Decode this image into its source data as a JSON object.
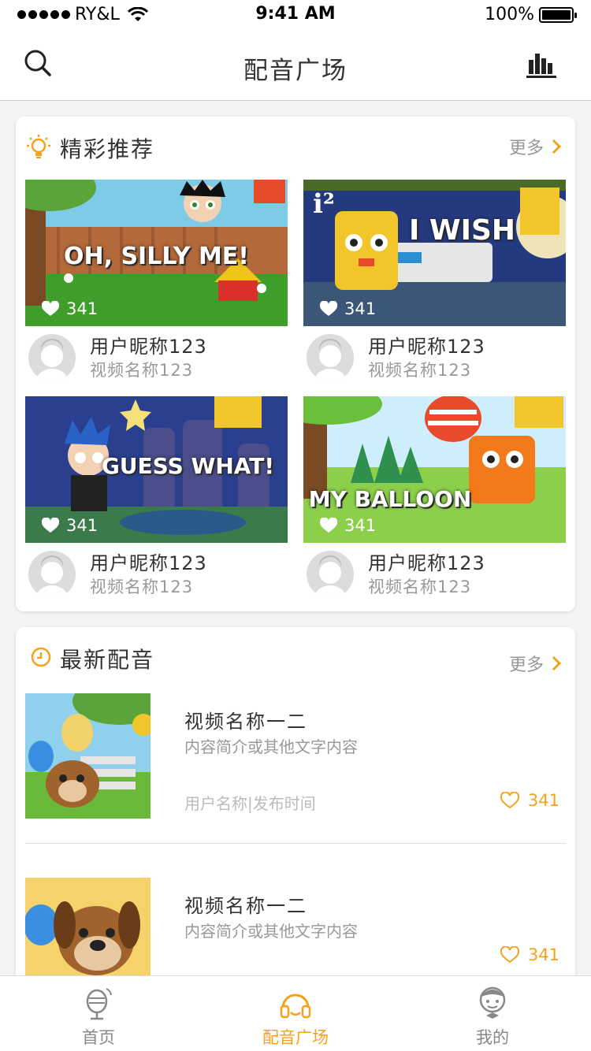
{
  "status_bar": {
    "carrier": "RY&L",
    "time": "9:41 AM",
    "battery": "100%"
  },
  "nav": {
    "title": "配音广场",
    "left_icon": "search-icon",
    "right_icon": "ranking-icon"
  },
  "featured": {
    "title": "精彩推荐",
    "more": "更多",
    "items": [
      {
        "caption": "OH, SILLY ME!",
        "likes": "341",
        "user": "用户昵称123",
        "video": "视频名称123"
      },
      {
        "caption": "I WISH",
        "likes": "341",
        "user": "用户昵称123",
        "video": "视频名称123"
      },
      {
        "caption": "GUESS WHAT!",
        "likes": "341",
        "user": "用户昵称123",
        "video": "视频名称123"
      },
      {
        "caption": "MY BALLOON",
        "likes": "341",
        "user": "用户昵称123",
        "video": "视频名称123"
      }
    ]
  },
  "latest": {
    "title": "最新配音",
    "more": "更多",
    "items": [
      {
        "title": "视频名称一二",
        "desc": "内容简介或其他文字内容",
        "meta": "用户名称|发布时间",
        "likes": "341"
      },
      {
        "title": "视频名称一二",
        "desc": "内容简介或其他文字内容",
        "meta": "",
        "likes": "341"
      }
    ]
  },
  "tabs": [
    {
      "label": "首页",
      "icon": "microphone-icon",
      "active": false
    },
    {
      "label": "配音广场",
      "icon": "headphones-icon",
      "active": true
    },
    {
      "label": "我的",
      "icon": "profile-icon",
      "active": false
    }
  ],
  "colors": {
    "accent": "#f7a11a",
    "text": "#333333",
    "muted": "#999999"
  }
}
